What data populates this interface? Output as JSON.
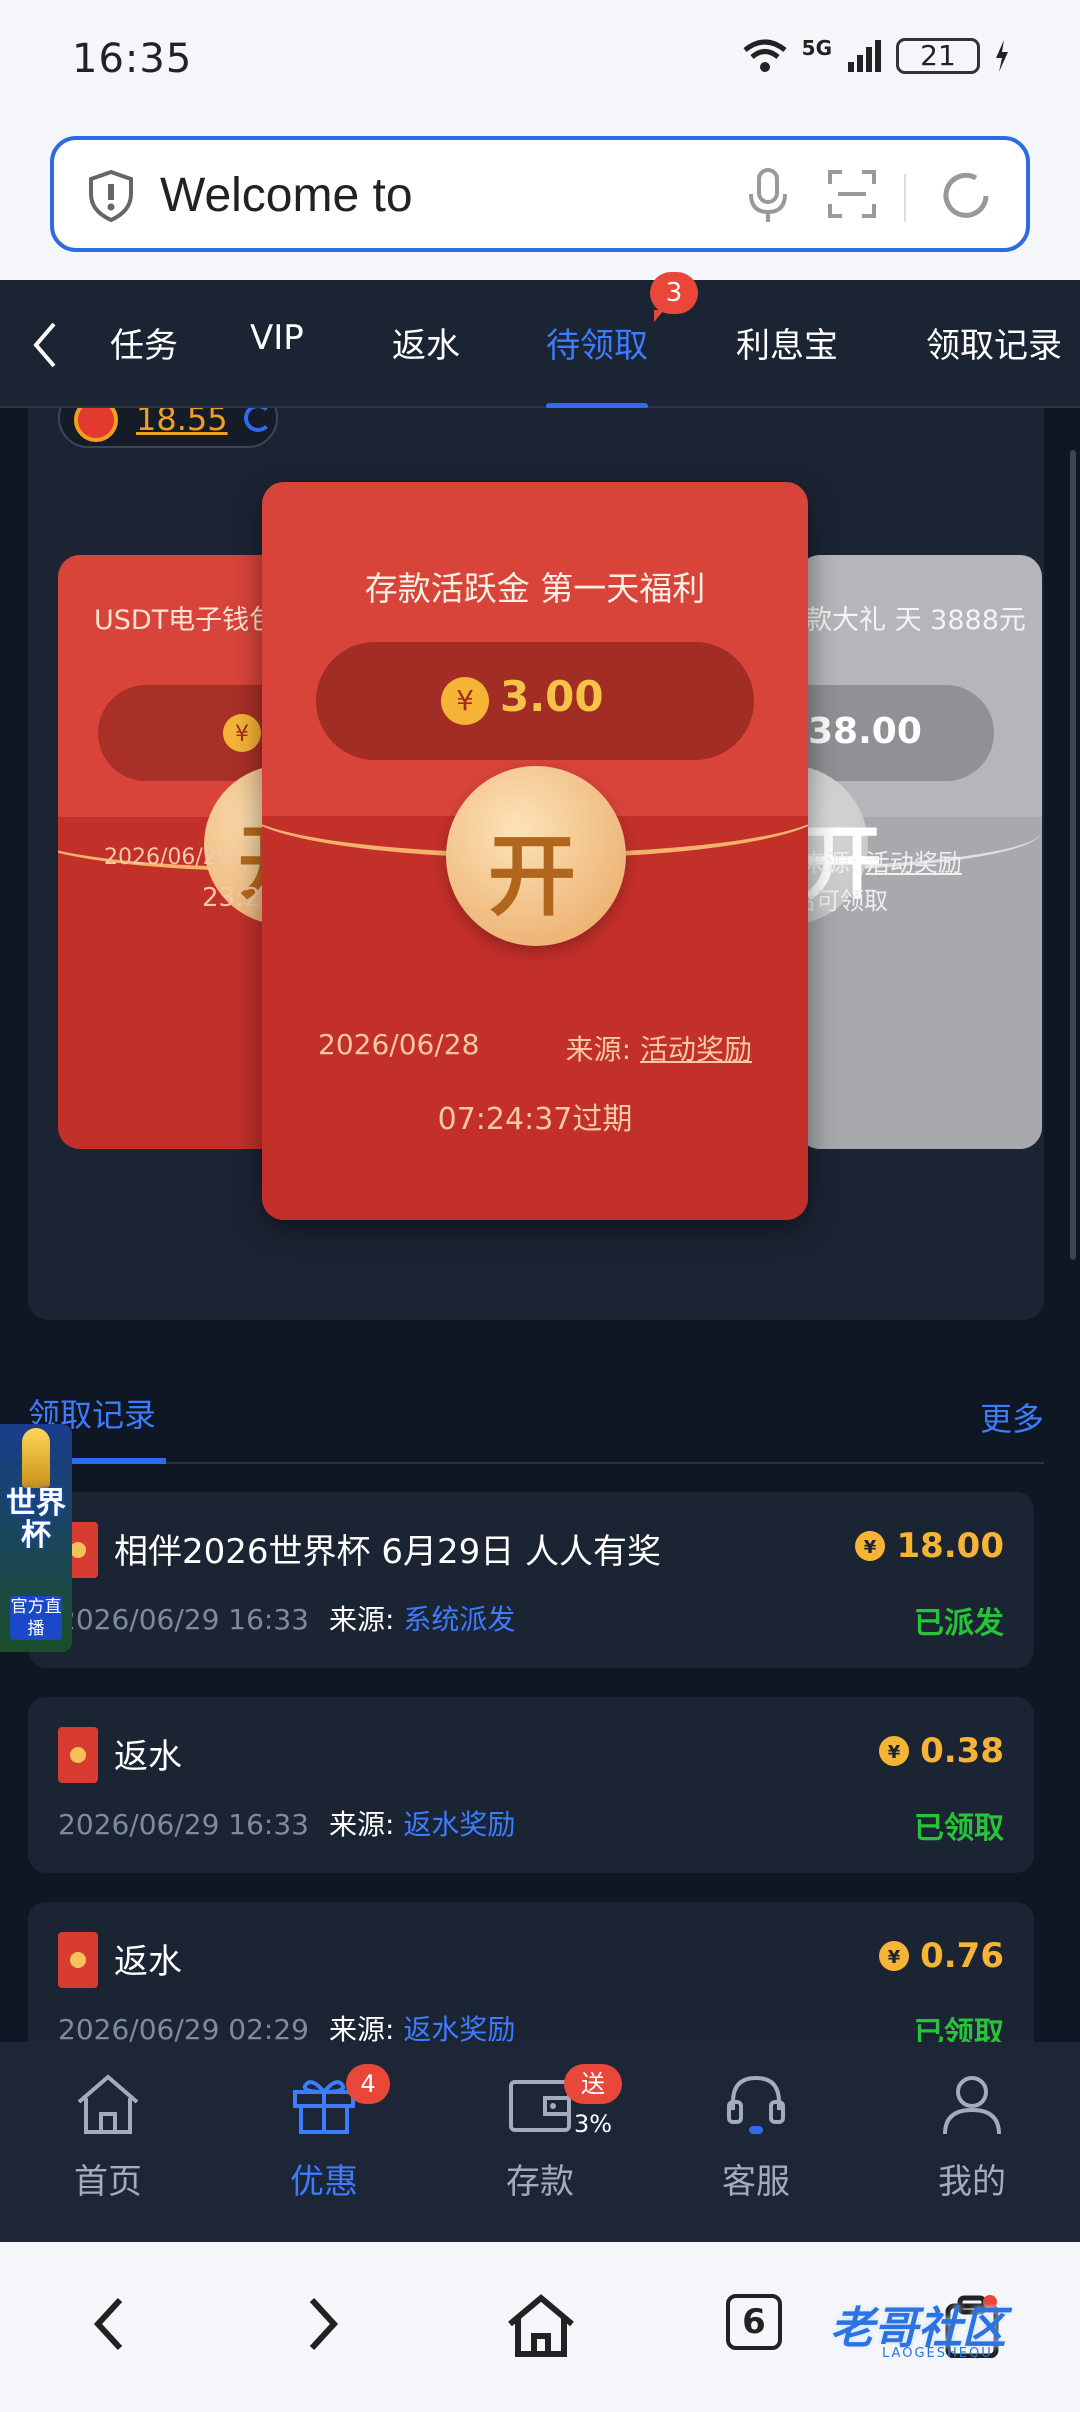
{
  "status_bar": {
    "time": "16:35",
    "network": "5G",
    "battery": "21"
  },
  "browser": {
    "url_text": "Welcome to"
  },
  "tabs": {
    "items": [
      {
        "label": "任务"
      },
      {
        "label": "VIP"
      },
      {
        "label": "返水"
      },
      {
        "label": "待领取",
        "badge": "3"
      },
      {
        "label": "利息宝"
      },
      {
        "label": "领取记录"
      }
    ],
    "active": "待领取"
  },
  "carousel": {
    "top_chip_value": "18.55",
    "left_card": {
      "title": "USDT电子钱包升级 E",
      "date": "2026/06/29",
      "expire": "23:24",
      "open_label": "开"
    },
    "center_card": {
      "title": "存款活跃金 第一天福利",
      "amount": "3.00",
      "open_label": "开",
      "date": "2026/06/28",
      "source_label": "来源:",
      "source_value": "活动奖励",
      "expire": "07:24:37过期"
    },
    "right_card": {
      "title": "取款大礼 天 3888元",
      "amount": "38.00",
      "open_label": "开",
      "source_label": "来源:",
      "source_value": "活动奖励",
      "note": "后可领取"
    }
  },
  "records": {
    "title": "领取记录",
    "more": "更多",
    "source_label": "来源:",
    "items": [
      {
        "name": "相伴2026世界杯 6月29日 人人有奖",
        "amount": "18.00",
        "datetime": "2026/06/29 16:33",
        "source": "系统派发",
        "status": "已派发"
      },
      {
        "name": "返水",
        "amount": "0.38",
        "datetime": "2026/06/29 16:33",
        "source": "返水奖励",
        "status": "已领取"
      },
      {
        "name": "返水",
        "amount": "0.76",
        "datetime": "2026/06/29 02:29",
        "source": "返水奖励",
        "status": "已领取"
      }
    ]
  },
  "worldcup_badge": {
    "line1": "世界杯",
    "line2": "官方直播"
  },
  "bottom_nav": {
    "items": [
      {
        "label": "首页"
      },
      {
        "label": "优惠",
        "badge": "4"
      },
      {
        "label": "存款",
        "badge": "送3%"
      },
      {
        "label": "客服"
      },
      {
        "label": "我的"
      }
    ],
    "active": "优惠"
  },
  "system_nav": {
    "tab_count": "6"
  },
  "watermark": {
    "text": "老哥社区",
    "sub": "LAOGESHEQU"
  },
  "colors": {
    "accent": "#3d7bff",
    "red_envelope": "#d8443a",
    "gold": "#f6b436",
    "success": "#27c43a",
    "bg": "#0f1724"
  },
  "icons": [
    "shield-icon",
    "mic-icon",
    "scan-icon",
    "reload-icon",
    "back-chevron-icon",
    "yuan-coin-icon",
    "home-icon",
    "gift-icon",
    "wallet-icon",
    "headset-icon",
    "user-icon",
    "forward-icon",
    "tabs-icon",
    "clipboard-icon"
  ]
}
